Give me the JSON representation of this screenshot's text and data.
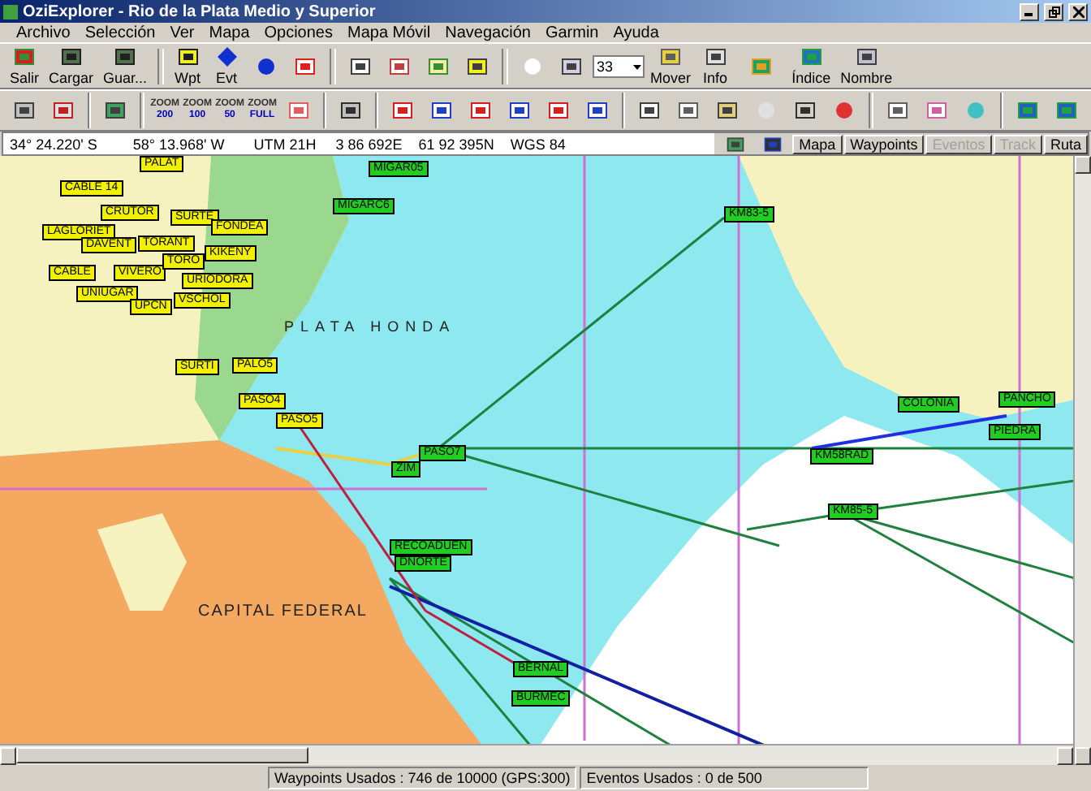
{
  "window": {
    "title": "OziExplorer - Rio de la Plata Medio y Superior"
  },
  "menu": [
    "Archivo",
    "Selección",
    "Ver",
    "Mapa",
    "Opciones",
    "Mapa Móvil",
    "Navegación",
    "Garmin",
    "Ayuda"
  ],
  "toolbar_main": [
    {
      "kind": "labeled",
      "label": "Salir"
    },
    {
      "kind": "labeled",
      "label": "Cargar"
    },
    {
      "kind": "labeled",
      "label": "Guar..."
    },
    {
      "kind": "labeled",
      "label": "Wpt"
    },
    {
      "kind": "labeled",
      "label": "Evt"
    },
    {
      "kind": "combo",
      "value": "33"
    },
    {
      "kind": "labeled",
      "label": "Mover"
    },
    {
      "kind": "labeled",
      "label": "Info"
    },
    {
      "kind": "labeled",
      "label": "Índice"
    },
    {
      "kind": "labeled",
      "label": "Nombre"
    }
  ],
  "toolbar_zoom": [
    {
      "label": "ZOOM",
      "value": "200"
    },
    {
      "label": "ZOOM",
      "value": "100"
    },
    {
      "label": "ZOOM",
      "value": "50"
    },
    {
      "label": "ZOOM",
      "value": "FULL"
    }
  ],
  "position": [
    "34° 24.220' S",
    "58° 13.968' W",
    "UTM  21H",
    "3 86 692E",
    "61 92 395N",
    "WGS 84"
  ],
  "tabs": [
    {
      "label": "Mapa",
      "disabled": false
    },
    {
      "label": "Waypoints",
      "disabled": false
    },
    {
      "label": "Eventos",
      "disabled": true
    },
    {
      "label": "Track",
      "disabled": true
    },
    {
      "label": "Ruta",
      "disabled": false
    }
  ],
  "map_labels": [
    "PLATA HONDA",
    "CAPITAL FEDERAL"
  ],
  "waypoints": [
    {
      "name": "PALAT",
      "color": "#f0f000"
    },
    {
      "name": "CABLE 14",
      "color": "#f0f000"
    },
    {
      "name": "CRUTOR",
      "color": "#f0f000"
    },
    {
      "name": "LAGLORIET",
      "color": "#f0f000"
    },
    {
      "name": "SURTE",
      "color": "#f0f000"
    },
    {
      "name": "FONDEA",
      "color": "#f0f000"
    },
    {
      "name": "DAVENT",
      "color": "#f0f000"
    },
    {
      "name": "TORANT",
      "color": "#f0f000"
    },
    {
      "name": "KIKENY",
      "color": "#f0f000"
    },
    {
      "name": "CABLE",
      "color": "#f0f000"
    },
    {
      "name": "VIVERO",
      "color": "#f0f000"
    },
    {
      "name": "TORO",
      "color": "#f0f000"
    },
    {
      "name": "URIODORA",
      "color": "#f0f000"
    },
    {
      "name": "UNIUGAR",
      "color": "#f0f000"
    },
    {
      "name": "VSCHOL",
      "color": "#f0f000"
    },
    {
      "name": "UPCN",
      "color": "#f0f000"
    },
    {
      "name": "SURTI",
      "color": "#f0f000"
    },
    {
      "name": "PALO5",
      "color": "#f0f000"
    },
    {
      "name": "PASO4",
      "color": "#f0f000"
    },
    {
      "name": "PASO5",
      "color": "#f0f000"
    },
    {
      "name": "MIGAR05",
      "color": "#22cc22"
    },
    {
      "name": "MIGARC6",
      "color": "#22cc22"
    },
    {
      "name": "KM83-5",
      "color": "#22cc22"
    },
    {
      "name": "PASO7",
      "color": "#22cc22"
    },
    {
      "name": "ZIM",
      "color": "#22cc22"
    },
    {
      "name": "KM58RAD",
      "color": "#22cc22"
    },
    {
      "name": "COLONIA",
      "color": "#22cc22"
    },
    {
      "name": "PANCHO",
      "color": "#22cc22"
    },
    {
      "name": "PIEDRA",
      "color": "#22cc22"
    },
    {
      "name": "KM85-5",
      "color": "#22cc22"
    },
    {
      "name": "RECOADUEN",
      "color": "#22cc22"
    },
    {
      "name": "DNORTE",
      "color": "#22cc22"
    },
    {
      "name": "BERNAL",
      "color": "#22cc22"
    },
    {
      "name": "BURMEC",
      "color": "#22cc22"
    }
  ],
  "status_bar": [
    "Waypoints Usados : 746 de 10000  (GPS:300)",
    "Eventos Usados : 0 de 500"
  ]
}
